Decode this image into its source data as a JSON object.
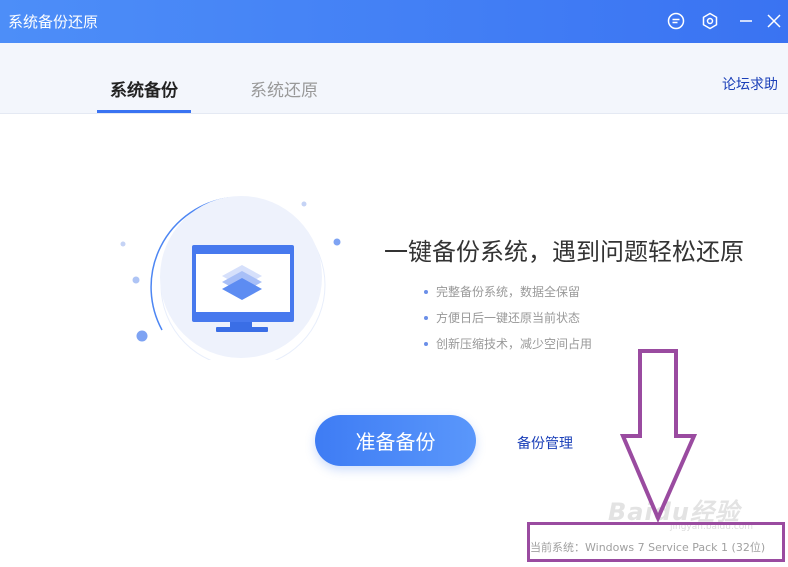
{
  "window": {
    "title": "系统备份还原",
    "icons": [
      "feedback-icon",
      "settings-icon",
      "minimize-icon",
      "close-icon"
    ]
  },
  "tabs": [
    {
      "label": "系统备份",
      "active": true
    },
    {
      "label": "系统还原",
      "active": false
    }
  ],
  "header": {
    "forum_link": "论坛求助"
  },
  "main": {
    "headline": "一键备份系统，遇到问题轻松还原",
    "features": [
      "完整备份系统，数据全保留",
      "方便日后一键还原当前状态",
      "创新压缩技术，减少空间占用"
    ],
    "primary_button": "准备备份",
    "manage_link": "备份管理"
  },
  "status": {
    "current_system": "当前系统：Windows 7 Service Pack 1 (32位)"
  },
  "watermark": {
    "text": "Baidu经验",
    "sub": "jingyan.baidu.com"
  },
  "colors": {
    "accent": "#3a73f2",
    "link": "#1a3fb8",
    "annotation": "#9a4ba0"
  }
}
